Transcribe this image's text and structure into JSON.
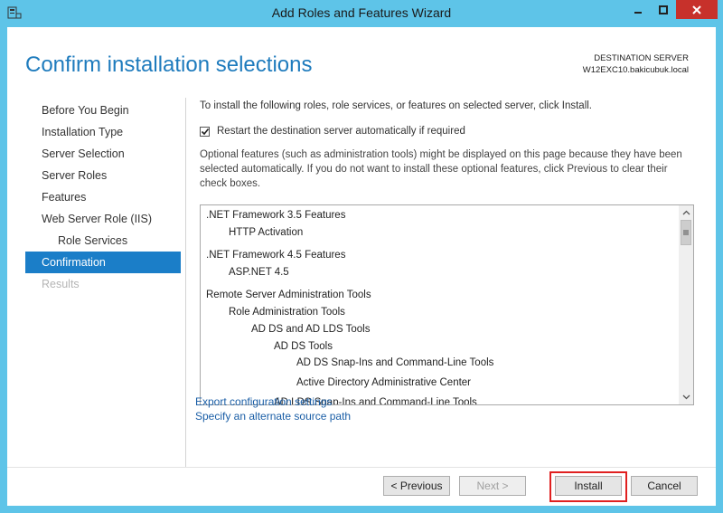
{
  "window": {
    "title": "Add Roles and Features Wizard",
    "accent_color": "#5ec4e8"
  },
  "header": {
    "page_title": "Confirm installation selections",
    "destination_label": "DESTINATION SERVER",
    "destination_server": "W12EXC10.bakicubuk.local"
  },
  "nav": {
    "items": [
      {
        "label": "Before You Begin",
        "state": "normal"
      },
      {
        "label": "Installation Type",
        "state": "normal"
      },
      {
        "label": "Server Selection",
        "state": "normal"
      },
      {
        "label": "Server Roles",
        "state": "normal"
      },
      {
        "label": "Features",
        "state": "normal"
      },
      {
        "label": "Web Server Role (IIS)",
        "state": "normal"
      },
      {
        "label": "Role Services",
        "state": "sub"
      },
      {
        "label": "Confirmation",
        "state": "active"
      },
      {
        "label": "Results",
        "state": "disabled"
      }
    ]
  },
  "main": {
    "intro_text": "To install the following roles, role services, or features on selected server, click Install.",
    "restart_checkbox": {
      "label": "Restart the destination server automatically if required",
      "checked": true
    },
    "optional_text": "Optional features (such as administration tools) might be displayed on this page because they have been selected automatically. If you do not want to install these optional features, click Previous to clear their check boxes.",
    "features": [
      {
        "label": ".NET Framework 3.5 Features",
        "level": 0
      },
      {
        "label": "HTTP Activation",
        "level": 1
      },
      {
        "label": ".NET Framework 4.5 Features",
        "level": 0
      },
      {
        "label": "ASP.NET 4.5",
        "level": 1
      },
      {
        "label": "Remote Server Administration Tools",
        "level": 0
      },
      {
        "label": "Role Administration Tools",
        "level": 1
      },
      {
        "label": "AD DS and AD LDS Tools",
        "level": 2
      },
      {
        "label": "AD DS Tools",
        "level": 3
      },
      {
        "label": "AD DS Snap-Ins and Command-Line Tools",
        "level": 4
      },
      {
        "label": "Active Directory Administrative Center",
        "level": 4
      },
      {
        "label": "AD LDS Snap-Ins and Command-Line Tools",
        "level": 3
      }
    ],
    "links": {
      "export": "Export configuration settings",
      "alternate_source": "Specify an alternate source path"
    }
  },
  "footer": {
    "previous": "< Previous",
    "next": "Next >",
    "install": "Install",
    "cancel": "Cancel"
  }
}
